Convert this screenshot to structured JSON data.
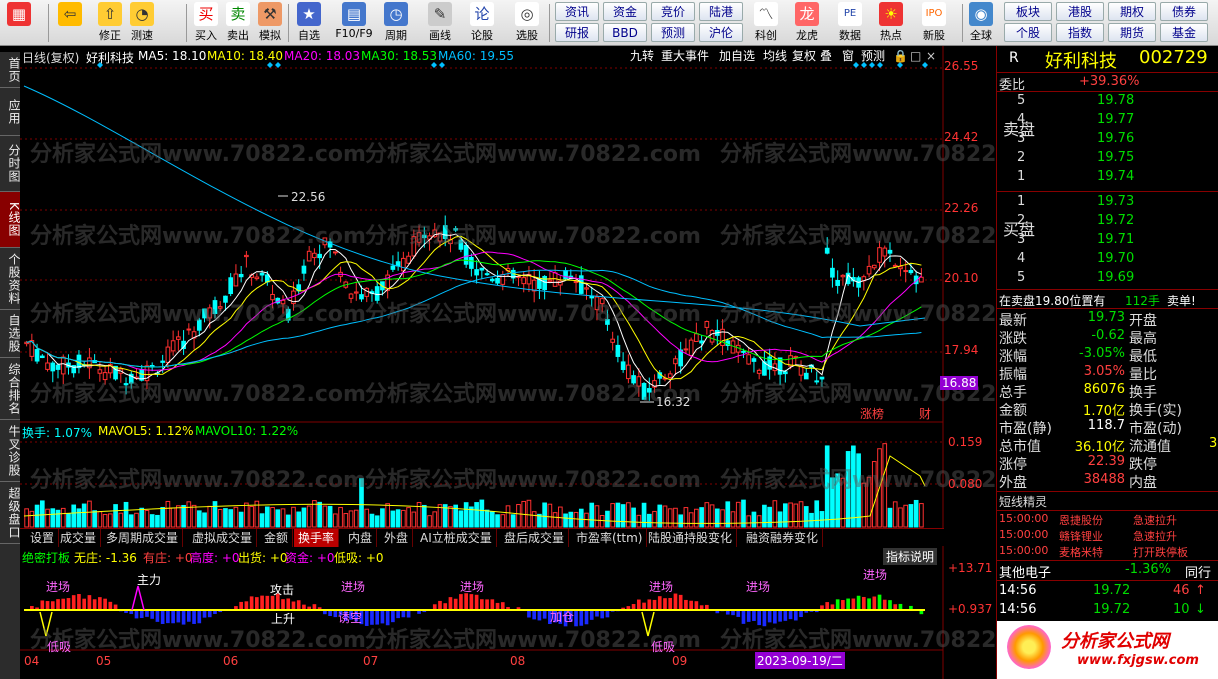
{
  "toolbar": {
    "buttons": [
      {
        "label": "",
        "icon": "grid-icon"
      },
      {
        "label": "",
        "icon": "back-arrow-icon"
      },
      {
        "label": "修正",
        "icon": "up-arrow-icon"
      },
      {
        "label": "测速",
        "icon": "speed-icon"
      },
      {
        "label": "买入",
        "icon": "buy-icon",
        "glyph": "买"
      },
      {
        "label": "卖出",
        "icon": "sell-icon",
        "glyph": "卖"
      },
      {
        "label": "模拟",
        "icon": "gavel-icon"
      },
      {
        "label": "自选",
        "icon": "star-icon"
      },
      {
        "label": "F10/F9",
        "icon": "f10-icon"
      },
      {
        "label": "周期",
        "icon": "period-icon"
      },
      {
        "label": "画线",
        "icon": "pencil-icon"
      },
      {
        "label": "论股",
        "icon": "discuss-icon"
      },
      {
        "label": "选股",
        "icon": "select-stock-icon"
      }
    ],
    "pills": [
      "资讯",
      "资金",
      "竞价",
      "陆港",
      "研报",
      "BBD",
      "预测",
      "沪伦"
    ],
    "buttons2": [
      {
        "label": "科创",
        "icon": "sci-icon"
      },
      {
        "label": "龙虎",
        "icon": "dragon-icon"
      },
      {
        "label": "数据",
        "icon": "pe-icon"
      },
      {
        "label": "热点",
        "icon": "hot-icon"
      },
      {
        "label": "新股",
        "icon": "ipo-icon"
      },
      {
        "label": "全球",
        "icon": "globe-icon"
      }
    ],
    "right_pills": [
      "板块",
      "港股",
      "期权",
      "债券",
      "个股",
      "指数",
      "期货",
      "基金"
    ]
  },
  "side_tabs": [
    "首页",
    "应用",
    "分时图",
    "K线图",
    "个股资料",
    "自选股",
    "综合排名",
    "牛叉诊股",
    "超级盘口"
  ],
  "side_active": "K线图",
  "chart_header": {
    "period": "日线(复权)",
    "name": "好利科技",
    "ma5": "MA5: 18.10",
    "ma10": "MA10: 18.40",
    "ma20": "MA20: 18.03",
    "ma30": "MA30: 18.53",
    "ma60": "MA60: 19.55",
    "buttons": [
      "九转",
      "重大事件",
      "加自选",
      "均线",
      "复权",
      "叠",
      "窗",
      "预测"
    ]
  },
  "price_axis": [
    "26.55",
    "24.42",
    "22.26",
    "20.10",
    "17.94",
    "16.88"
  ],
  "annotations": {
    "high": "22.56",
    "low": "16.32",
    "tag1": "涨榜",
    "tag2": "财"
  },
  "volume_header": {
    "a": "换手: 1.07%",
    "b": "MAVOL5: 1.12%",
    "c": "MAVOL10: 1.22%"
  },
  "volume_axis": [
    "0.159",
    "0.080"
  ],
  "indicator_tabs": [
    "设置",
    "成交量",
    "多周期成交量",
    "虚拟成交量",
    "金额",
    "换手率",
    "内盘",
    "外盘",
    "AI立桩成交量",
    "盘后成交量",
    "市盈率(ttm)",
    "陆股通持股变化",
    "融资融券变化"
  ],
  "indicator_active": "换手率",
  "indicator_explain": "指标说明",
  "lower_header": {
    "name": "绝密打板",
    "none": "无庄: -1.36",
    "has": "有庄: +0",
    "high": "高度: +0",
    "out": "出货: +0",
    "fund": "资金: +0",
    "low": "低吸: +0"
  },
  "lower_axis": [
    "+13.71",
    "+0.937"
  ],
  "lower_labels": [
    "进场",
    "主力",
    "攻击",
    "进场",
    "进场",
    "进场",
    "进场",
    "上升",
    "诱空",
    "加仓",
    "低吸",
    "低吸",
    "进场"
  ],
  "months": [
    "04",
    "05",
    "06",
    "07",
    "08",
    "09"
  ],
  "date_cursor": "2023-09-19/二",
  "right_panel": {
    "r_label": "R",
    "stock_name": "好利科技",
    "stock_code": "002729",
    "weibi_label": "委比",
    "weibi_value": "+39.36%",
    "sell_label": "卖盘",
    "buy_label": "买盘",
    "sell": [
      {
        "n": "5",
        "p": "19.78"
      },
      {
        "n": "4",
        "p": "19.77"
      },
      {
        "n": "3",
        "p": "19.76"
      },
      {
        "n": "2",
        "p": "19.75"
      },
      {
        "n": "1",
        "p": "19.74"
      }
    ],
    "buy": [
      {
        "n": "1",
        "p": "19.73"
      },
      {
        "n": "2",
        "p": "19.72"
      },
      {
        "n": "3",
        "p": "19.71"
      },
      {
        "n": "4",
        "p": "19.70"
      },
      {
        "n": "5",
        "p": "19.69"
      }
    ],
    "notice": "在卖盘19.80位置有",
    "notice_qty": "112手",
    "notice_tag": "卖单!",
    "quotes": [
      {
        "l": "最新",
        "v": "19.73",
        "l2": "开盘",
        "c": "#00dd00"
      },
      {
        "l": "涨跌",
        "v": "-0.62",
        "l2": "最高",
        "c": "#00dd00"
      },
      {
        "l": "涨幅",
        "v": "-3.05%",
        "l2": "最低",
        "c": "#00dd00"
      },
      {
        "l": "振幅",
        "v": "3.05%",
        "l2": "量比",
        "c": "#ff4040"
      },
      {
        "l": "总手",
        "v": "86076",
        "l2": "换手",
        "c": "#ffff00"
      },
      {
        "l": "金额",
        "v": "1.70亿",
        "l2": "换手(实)",
        "c": "#ffff00"
      },
      {
        "l": "市盈(静)",
        "v": "118.7",
        "l2": "市盈(动)",
        "c": "#ffffff"
      },
      {
        "l": "总市值",
        "v": "36.10亿",
        "l2": "流通值",
        "c": "#ffff00"
      },
      {
        "l": "涨停",
        "v": "22.39",
        "l2": "跌停",
        "c": "#ff4040"
      },
      {
        "l": "外盘",
        "v": "38488",
        "l2": "内盘",
        "c": "#ff4040"
      }
    ],
    "hidden_right": "3",
    "short_title": "短线精灵",
    "short": [
      {
        "t": "15:00:00",
        "n": "恩捷股份",
        "e": "急速拉升"
      },
      {
        "t": "15:00:00",
        "n": "赣锋锂业",
        "e": "急速拉升"
      },
      {
        "t": "15:00:00",
        "n": "麦格米特",
        "e": "打开跌停板"
      }
    ],
    "sector_name": "其他电子",
    "sector_change": "-1.36%",
    "sector_btn": "同行",
    "ticks": [
      {
        "t": "14:56",
        "p": "19.72",
        "q": "46",
        "arrow": "↑",
        "c": "#ff4040"
      },
      {
        "t": "14:56",
        "p": "19.72",
        "q": "10",
        "arrow": "↓",
        "c": "#00dd00"
      }
    ],
    "logo_text": "分析家公式网",
    "logo_url": "www.fxjgsw.com"
  },
  "watermark": "分析家公式网www.70822.com",
  "colors": {
    "up": "#ff3030",
    "down": "#00ffff",
    "ma5": "#ffffff",
    "ma10": "#ffff00",
    "ma20": "#ff00ff",
    "ma30": "#00ff00",
    "ma60": "#00bfff",
    "grid": "#800000"
  }
}
